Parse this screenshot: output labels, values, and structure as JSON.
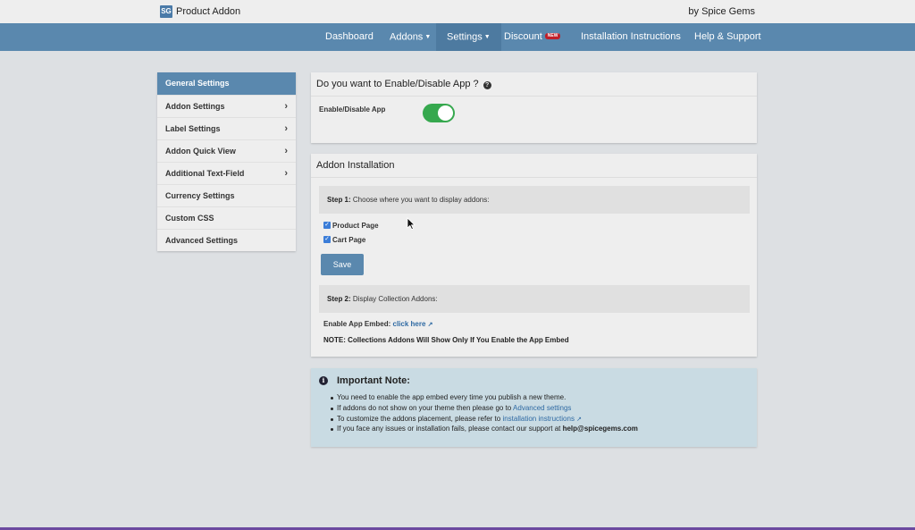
{
  "header": {
    "logo_text": "SG",
    "app_title": "Product Addon",
    "byline": "by Spice Gems"
  },
  "nav": {
    "items": [
      {
        "label": "Dashboard"
      },
      {
        "label": "Addons"
      },
      {
        "label": "Settings"
      },
      {
        "label": "Discount",
        "badge": "NEW"
      },
      {
        "label": "Installation Instructions"
      },
      {
        "label": "Help & Support"
      }
    ]
  },
  "sidebar": {
    "items": [
      {
        "label": "General Settings"
      },
      {
        "label": "Addon Settings"
      },
      {
        "label": "Label Settings"
      },
      {
        "label": "Addon Quick View"
      },
      {
        "label": "Additional Text-Field"
      },
      {
        "label": "Currency Settings"
      },
      {
        "label": "Custom CSS"
      },
      {
        "label": "Advanced Settings"
      }
    ]
  },
  "enable_card": {
    "title": "Do you want to Enable/Disable App ?",
    "toggle_label": "Enable/Disable App",
    "toggle_on": true
  },
  "install_card": {
    "title": "Addon Installation",
    "step1_prefix": "Step 1:",
    "step1_text": "Choose where you want to display addons:",
    "option_product": "Product Page",
    "option_cart": "Cart Page",
    "save_label": "Save",
    "step2_prefix": "Step 2:",
    "step2_text": "Display Collection Addons:",
    "embed_label": "Enable App Embed:",
    "embed_link": "click here",
    "note": "NOTE: Collections Addons Will Show Only If You Enable the App Embed"
  },
  "info": {
    "title": "Important Note:",
    "line1": "You need to enable the app embed every time you publish a new theme.",
    "line2_prefix": "If addons do not show on your theme then please go to",
    "line2_link": "Advanced settings",
    "line3_prefix": "To customize the addons placement, please refer to",
    "line3_link": "installation instructions",
    "line4_prefix": "If you face any issues or installation fails, please contact our support at",
    "line4_email": "help@spicegems.com"
  },
  "colors": {
    "nav_bg": "#5a88ae",
    "toggle_on": "#36a84e",
    "link": "#2f6aa3",
    "info_bg": "#c9dbe3"
  }
}
